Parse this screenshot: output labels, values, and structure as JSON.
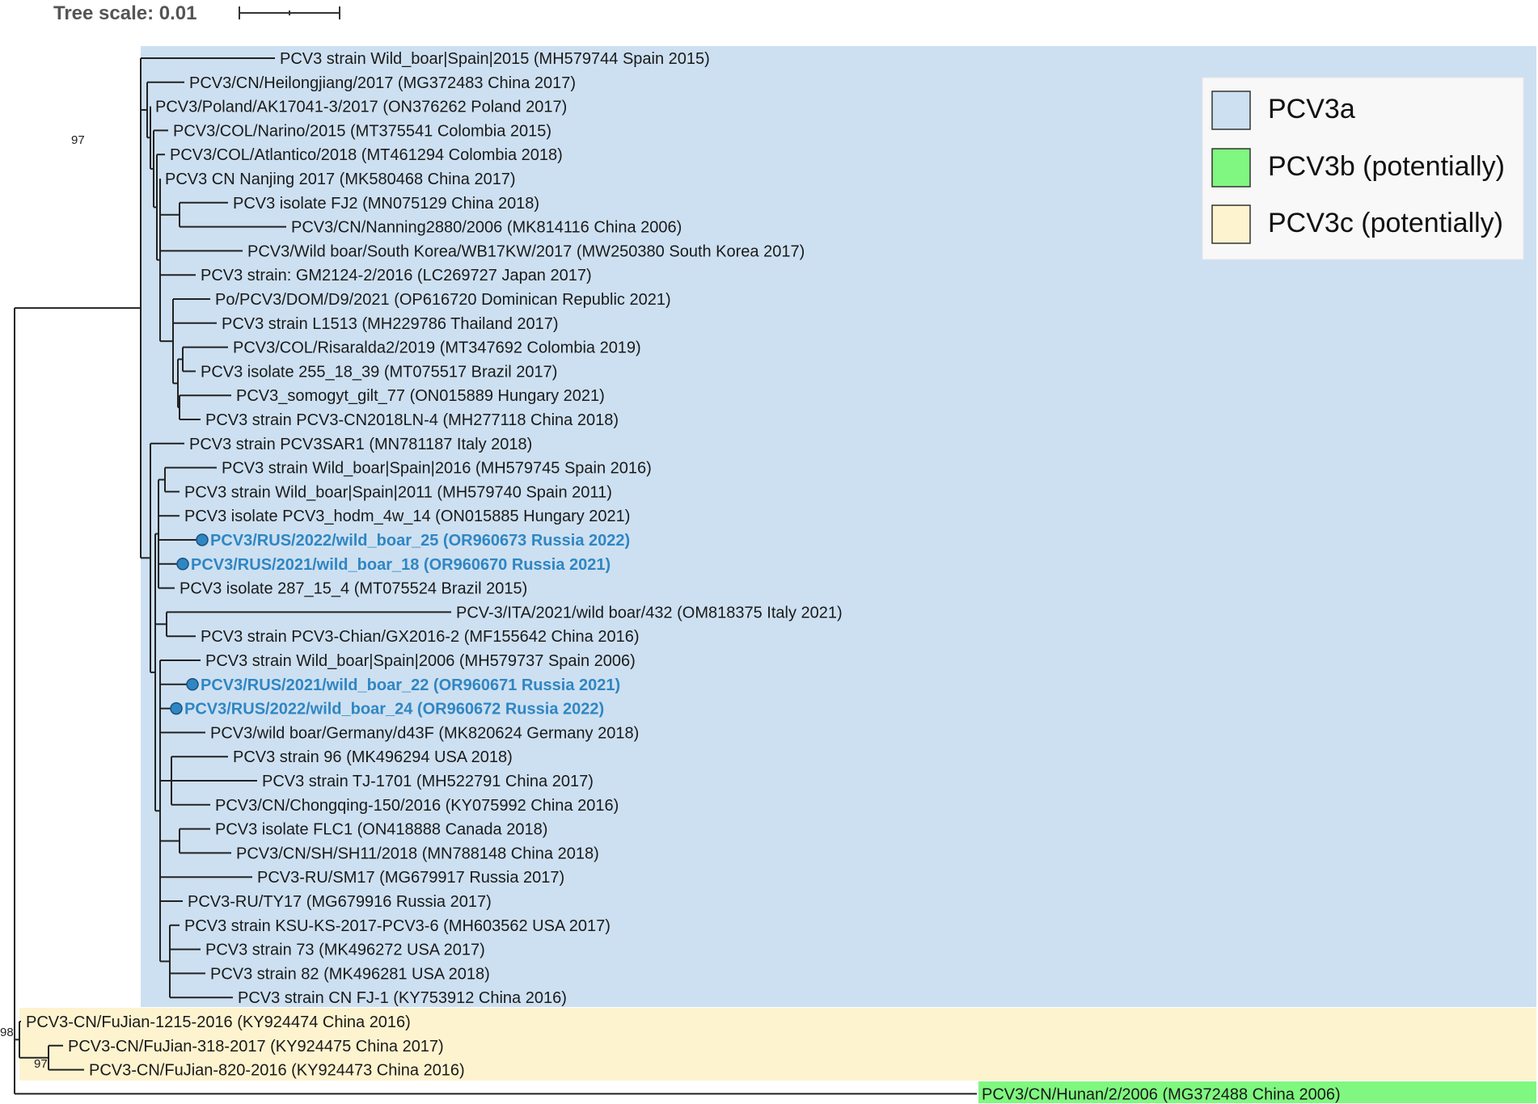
{
  "scale": {
    "label": "Tree scale: 0.01"
  },
  "legend": {
    "items": [
      {
        "label": "PCV3a",
        "color": "#cde0f1"
      },
      {
        "label": "PCV3b (potentially)",
        "color": "#80f780"
      },
      {
        "label": "PCV3c (potentially)",
        "color": "#fdf3cf"
      }
    ]
  },
  "highlight_color": "#2f86c3",
  "leaves": [
    "PCV3 strain Wild_boar|Spain|2015 (MH579744 Spain 2015)",
    "PCV3/CN/Heilongjiang/2017 (MG372483 China 2017)",
    "PCV3/Poland/AK17041-3/2017 (ON376262 Poland 2017)",
    "PCV3/COL/Narino/2015 (MT375541 Colombia 2015)",
    "PCV3/COL/Atlantico/2018 (MT461294 Colombia 2018)",
    "PCV3 CN Nanjing 2017 (MK580468 China 2017)",
    "PCV3 isolate FJ2 (MN075129 China 2018)",
    "PCV3/CN/Nanning2880/2006 (MK814116 China 2006)",
    "PCV3/Wild boar/South Korea/WB17KW/2017 (MW250380 South Korea 2017)",
    "PCV3 strain: GM2124-2/2016 (LC269727 Japan 2017)",
    "Po/PCV3/DOM/D9/2021 (OP616720 Dominican Republic 2021)",
    "PCV3 strain L1513 (MH229786 Thailand 2017)",
    "PCV3/COL/Risaralda2/2019 (MT347692 Colombia 2019)",
    "PCV3 isolate 255_18_39 (MT075517 Brazil 2017)",
    "PCV3_somogyt_gilt_77 (ON015889 Hungary 2021)",
    "PCV3 strain PCV3-CN2018LN-4 (MH277118 China 2018)",
    "PCV3 strain PCV3SAR1 (MN781187 Italy 2018)",
    "PCV3 strain Wild_boar|Spain|2016 (MH579745 Spain 2016)",
    "PCV3 strain Wild_boar|Spain|2011 (MH579740 Spain 2011)",
    "PCV3 isolate PCV3_hodm_4w_14 (ON015885 Hungary 2021)",
    "PCV3/RUS/2022/wild_boar_25 (OR960673 Russia 2022)",
    "PCV3/RUS/2021/wild_boar_18 (OR960670 Russia 2021)",
    "PCV3 isolate 287_15_4 (MT075524 Brazil 2015)",
    "PCV-3/ITA/2021/wild boar/432 (OM818375 Italy 2021)",
    "PCV3 strain PCV3-Chian/GX2016-2 (MF155642 China 2016)",
    "PCV3 strain Wild_boar|Spain|2006 (MH579737 Spain 2006)",
    "PCV3/RUS/2021/wild_boar_22 (OR960671 Russia 2021)",
    "PCV3/RUS/2022/wild_boar_24 (OR960672 Russia 2022)",
    "PCV3/wild boar/Germany/d43F (MK820624 Germany 2018)",
    "PCV3 strain 96 (MK496294 USA 2018)",
    "PCV3 strain TJ-1701 (MH522791 China 2017)",
    "PCV3/CN/Chongqing-150/2016 (KY075992 China 2016)",
    "PCV3 isolate FLC1 (ON418888 Canada 2018)",
    "PCV3/CN/SH/SH11/2018 (MN788148 China 2018)",
    "PCV3-RU/SM17 (MG679917 Russia 2017)",
    "PCV3-RU/TY17 (MG679916 Russia 2017)",
    "PCV3 strain KSU-KS-2017-PCV3-6 (MH603562 USA 2017)",
    "PCV3 strain 73 (MK496272 USA 2017)",
    "PCV3 strain 82 (MK496281 USA 2018)",
    "PCV3 strain CN FJ-1 (KY753912 China 2016)",
    "PCV3-CN/FuJian-1215-2016 (KY924474 China 2016)",
    "PCV3-CN/FuJian-318-2017 (KY924475 China 2017)",
    "PCV3-CN/FuJian-820-2016 (KY924473 China 2016)",
    "PCV3/CN/Hunan/2/2006 (MG372488 China 2006)"
  ],
  "highlighted_leaves": [
    20,
    21,
    26,
    27
  ],
  "bootstrap": [
    {
      "value": "97"
    },
    {
      "value": "98"
    },
    {
      "value": "97"
    }
  ]
}
